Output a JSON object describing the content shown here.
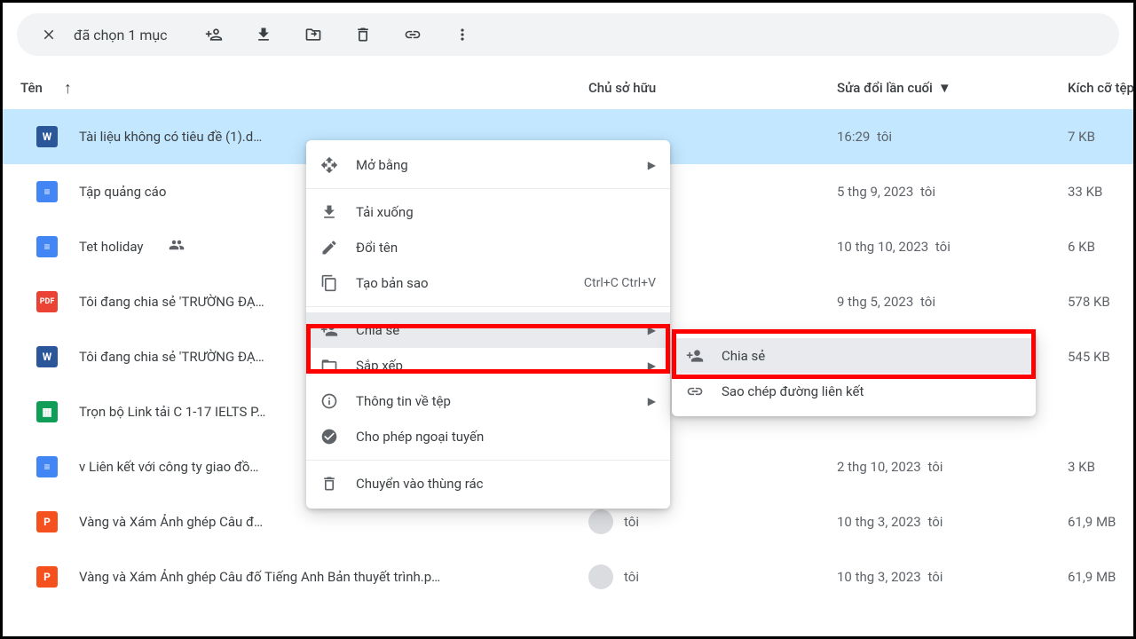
{
  "selection": {
    "text": "đã chọn 1 mục"
  },
  "columns": {
    "name": "Tên",
    "owner": "Chủ sở hữu",
    "modified": "Sửa đổi lần cuối",
    "size": "Kích cỡ tệp"
  },
  "files": [
    {
      "icon": "word",
      "name": "Tài liệu không có tiêu đề (1).d…",
      "owner": "",
      "modified": "16:29",
      "who": "tôi",
      "size": "7 KB",
      "selected": true
    },
    {
      "icon": "docs",
      "name": "Tập quảng cáo",
      "owner": "",
      "modified": "5 thg 9, 2023",
      "who": "tôi",
      "size": "33 KB",
      "selected": false
    },
    {
      "icon": "docs",
      "name": "Tet holiday",
      "shared": true,
      "owner": "",
      "modified": "10 thg 10, 2023",
      "who": "tôi",
      "size": "6 KB",
      "selected": false
    },
    {
      "icon": "pdf",
      "name": "Tôi đang chia sẻ 'TRƯỜNG ĐẠ…",
      "owner": "",
      "modified": "9 thg 5, 2023",
      "who": "tôi",
      "size": "578 KB",
      "selected": false
    },
    {
      "icon": "word",
      "name": "Tôi đang chia sẻ 'TRƯỜNG ĐẠ…",
      "owner": "",
      "modified": "",
      "who": "",
      "size": "545 KB",
      "selected": false
    },
    {
      "icon": "sheets",
      "name": "Trọn bộ Link tải C 1-17 IELTS P…",
      "owner": "",
      "modified": "",
      "who": "",
      "size": "",
      "selected": false
    },
    {
      "icon": "docs",
      "name": "v Liên kết với công ty giao đồ…",
      "owner": "",
      "modified": "2 thg 10, 2023",
      "who": "tôi",
      "size": "3 KB",
      "selected": false
    },
    {
      "icon": "slides",
      "name": "Vàng và Xám Ảnh ghép Câu đ…",
      "owner": "tôi",
      "avatar": true,
      "modified": "10 thg 3, 2023",
      "who": "tôi",
      "size": "61,9 MB",
      "selected": false
    },
    {
      "icon": "slides",
      "name": "Vàng và Xám Ảnh ghép Câu đố Tiếng Anh Bản thuyết trình.p…",
      "owner": "tôi",
      "avatar": true,
      "modified": "10 thg 3, 2023",
      "who": "tôi",
      "size": "61,9 MB",
      "selected": false
    }
  ],
  "menu": [
    {
      "icon": "open",
      "label": "Mở bằng",
      "arrow": true
    },
    {
      "sep": true
    },
    {
      "icon": "download",
      "label": "Tải xuống"
    },
    {
      "icon": "rename",
      "label": "Đổi tên"
    },
    {
      "icon": "copy",
      "label": "Tạo bản sao",
      "shortcut": "Ctrl+C Ctrl+V"
    },
    {
      "sep": true
    },
    {
      "icon": "share",
      "label": "Chia sẻ",
      "arrow": true,
      "highlight": true
    },
    {
      "icon": "organize",
      "label": "Sắp xếp",
      "arrow": true
    },
    {
      "icon": "info",
      "label": "Thông tin về tệp",
      "arrow": true
    },
    {
      "icon": "offline",
      "label": "Cho phép ngoại tuyến"
    },
    {
      "sep": true
    },
    {
      "icon": "trash",
      "label": "Chuyển vào thùng rác"
    }
  ],
  "submenu": [
    {
      "icon": "share",
      "label": "Chia sẻ",
      "highlight": true
    },
    {
      "icon": "link",
      "label": "Sao chép đường liên kết"
    }
  ]
}
